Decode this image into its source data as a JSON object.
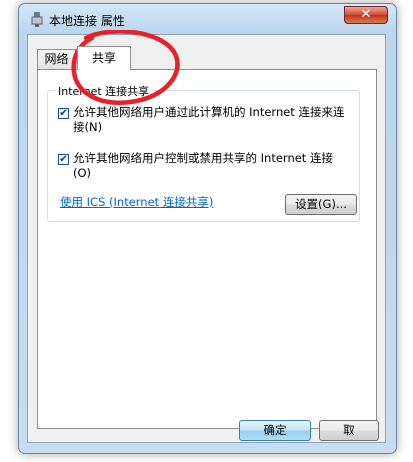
{
  "window": {
    "title": "本地连接 属性",
    "close_glyph": "✕"
  },
  "tabs": [
    {
      "label": "网络",
      "selected": false
    },
    {
      "label": "共享",
      "selected": true
    }
  ],
  "group": {
    "legend": "Internet 连接共享"
  },
  "options": [
    {
      "label": "允许其他网络用户通过此计算机的 Internet 连接来连接(N)",
      "checked": true
    },
    {
      "label": "允许其他网络用户控制或禁用共享的 Internet 连接(O)",
      "checked": true
    }
  ],
  "link": {
    "label": "使用 ICS (Internet 连接共享)"
  },
  "buttons": {
    "settings": "设置(G)...",
    "ok": "确定",
    "cancel": "取"
  },
  "checkmark": "✔",
  "colors": {
    "annotation": "#e8202a",
    "link": "#0066cc"
  }
}
